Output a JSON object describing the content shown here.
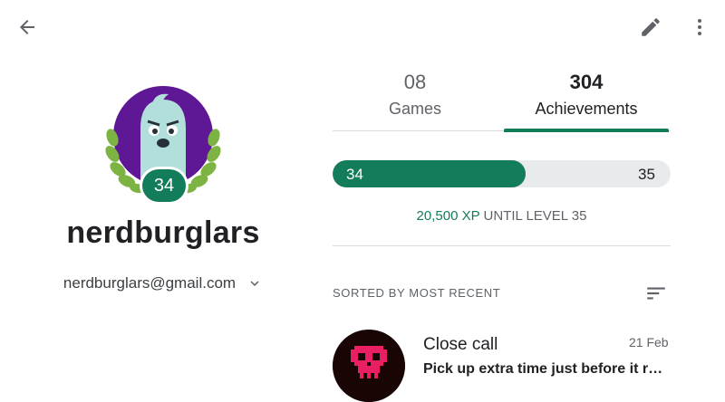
{
  "profile": {
    "username": "nerdburglars",
    "email": "nerdburglars@gmail.com",
    "level": "34"
  },
  "tabs": [
    {
      "count": "08",
      "label": "Games",
      "selected": false
    },
    {
      "count": "304",
      "label": "Achievements",
      "selected": true
    }
  ],
  "progress": {
    "current_level": "34",
    "next_level": "35",
    "fraction": 0.57,
    "xp_value": "20,500 XP",
    "xp_suffix": " UNTIL LEVEL 35"
  },
  "sort": {
    "label": "SORTED BY MOST RECENT"
  },
  "achievements": [
    {
      "title": "Close call",
      "date": "21 Feb",
      "description": "Pick up extra time just before it runs out"
    }
  ],
  "colors": {
    "accent": "#137c5a",
    "track": "#e8eaed",
    "avatar_bg": "#6a1b9a",
    "laurel": "#7cb342"
  },
  "icons": {
    "back": "arrow-back-icon",
    "edit": "pencil-edit-icon",
    "more": "more-vert-icon",
    "dropdown": "chevron-down-icon",
    "sort": "sort-icon"
  }
}
